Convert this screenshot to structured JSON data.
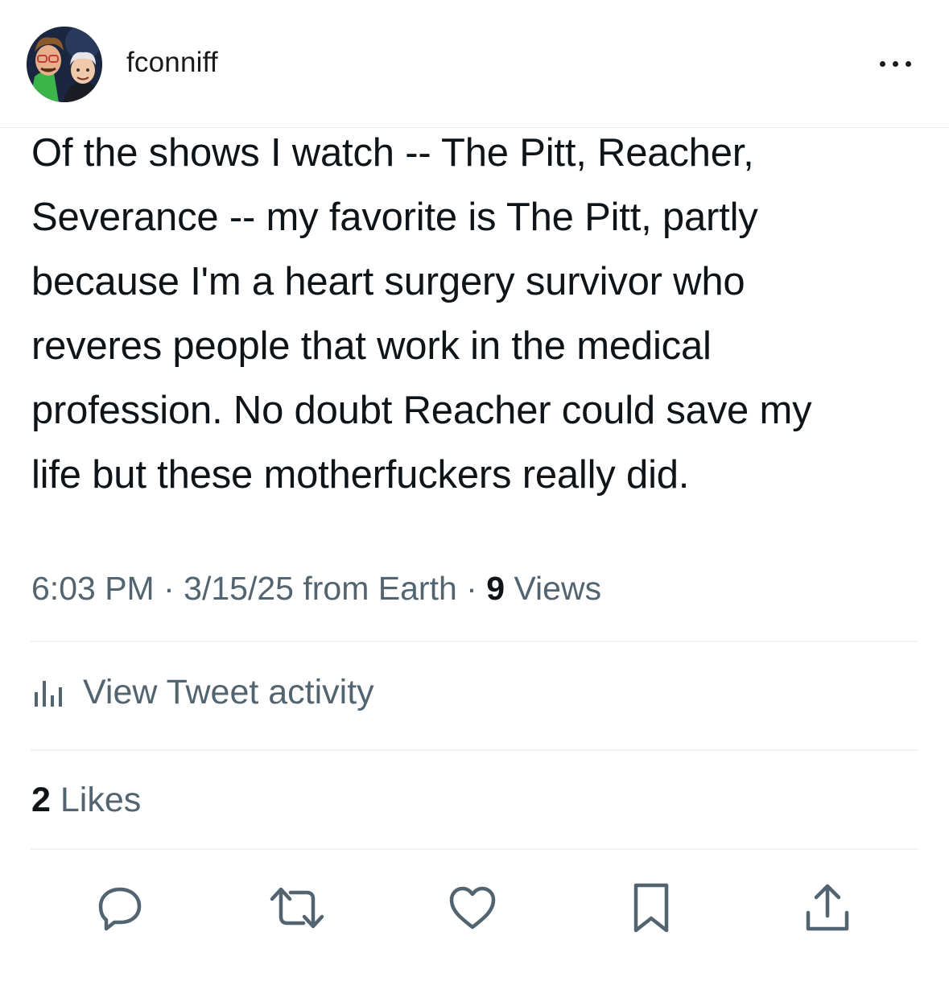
{
  "header": {
    "username": "fconniff",
    "more_label": "More options"
  },
  "tweet": {
    "lines": [
      "Of the shows I watch -- The Pitt, Reacher,",
      "Severance -- my favorite is The Pitt, partly",
      "because I'm a heart surgery survivor who",
      "reveres people that work in the medical",
      "profession. No doubt Reacher could save my",
      "life but these motherfuckers really did."
    ],
    "time": "6:03 PM",
    "date": "3/15/25",
    "source": "from Earth",
    "separator": "·",
    "views_count": "9",
    "views_label": "Views"
  },
  "activity": {
    "label": "View Tweet activity",
    "icon": "bar-chart-icon"
  },
  "likes": {
    "count": "2",
    "label": "Likes"
  },
  "actions": {
    "icons": [
      "reply-icon",
      "retweet-icon",
      "like-icon",
      "bookmark-icon",
      "share-icon"
    ]
  },
  "colors": {
    "text_primary": "#0f1419",
    "text_secondary": "#536471",
    "divider": "#eff3f4"
  }
}
